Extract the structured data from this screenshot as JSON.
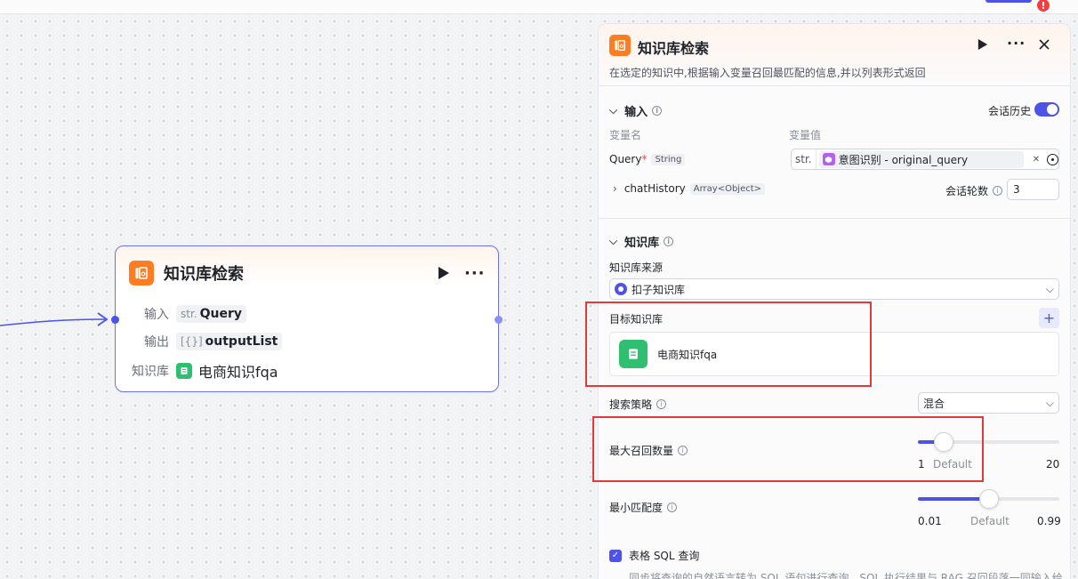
{
  "topbar": {
    "alert_badge": "!"
  },
  "node": {
    "title": "知识库检索",
    "input_label": "输入",
    "input_type": "str.",
    "input_value": "Query",
    "output_label": "输出",
    "output_type": "[{}]",
    "output_value": "outputList",
    "kb_label": "知识库",
    "kb_value": "电商知识fqa"
  },
  "panel": {
    "title": "知识库检索",
    "description": "在选定的知识中,根据输入变量召回最匹配的信息,并以列表形式返回",
    "input_section": {
      "title": "输入",
      "history_label": "会话历史",
      "col_name": "变量名",
      "col_value": "变量值",
      "query_name": "Query",
      "query_required": "*",
      "query_type": "String",
      "query_ref_prefix": "str.",
      "query_ref_value": "意图识别 - original_query",
      "chat_history_name": "chatHistory",
      "chat_history_type": "Array<Object>",
      "rounds_label": "会话轮数",
      "rounds_value": "3"
    },
    "kb_section": {
      "title": "知识库",
      "source_label": "知识库来源",
      "source_value": "扣子知识库",
      "target_label": "目标知识库",
      "target_item": "电商知识fqa",
      "strategy_label": "搜索策略",
      "strategy_value": "混合",
      "max_recall_label": "最大召回数量",
      "max_recall_min": "1",
      "max_recall_default": "Default",
      "max_recall_max": "20",
      "max_recall_fraction": 0.18,
      "min_match_label": "最小匹配度",
      "min_match_min": "0.01",
      "min_match_default": "Default",
      "min_match_max": "0.99",
      "min_match_fraction": 0.5,
      "sql_label": "表格 SQL 查询",
      "sql_desc": "同步将查询的自然语言转为 SQL 语句进行查询，SQL 执行结果与 RAG 召回段落一同输入给"
    }
  },
  "colors": {
    "accent": "#4d53e8",
    "node_icon": "#ff7d22",
    "kb_green": "#2fbf71",
    "highlight": "#e03a3a"
  }
}
